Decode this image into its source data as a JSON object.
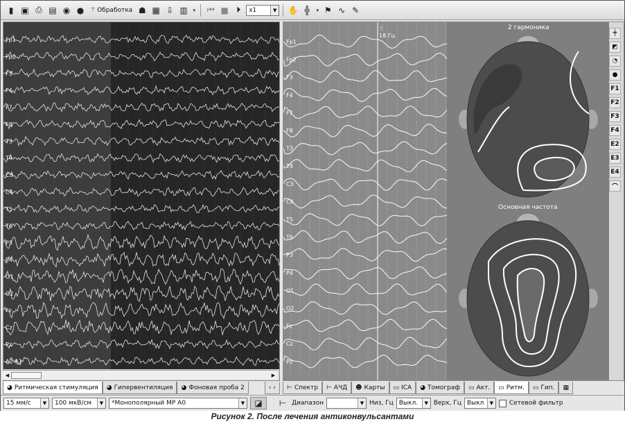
{
  "toolbar": {
    "processing_label": "Обработка",
    "speed_value": "x1"
  },
  "left_channels": [
    "Fp1",
    "Fp2",
    "F3",
    "F4",
    "F7",
    "F8",
    "T3",
    "T4",
    "C3",
    "C4",
    "T5",
    "T6",
    "P3",
    "P4",
    "O1",
    "O2",
    "Fz",
    "Cz",
    "Pz",
    "A2-A1"
  ],
  "right_channels": [
    "Fp1",
    "Fp2",
    "F3",
    "F4",
    "F7",
    "F8",
    "T3",
    "T4",
    "C3",
    "C4",
    "T5",
    "T6",
    "P3",
    "P4",
    "O1",
    "O2",
    "Fz",
    "Cz",
    "Pz"
  ],
  "cursor_readout": "18 Гц",
  "maps": {
    "top_title": "2 гармоника",
    "bottom_title": "Основная частота"
  },
  "left_tabs": [
    {
      "label": "Ритмическая стимуляция",
      "icon": "photic-icon"
    },
    {
      "label": "Гипервентиляция",
      "icon": "breath-icon"
    },
    {
      "label": "Фоновая проба 2",
      "icon": "background-icon"
    }
  ],
  "right_tabs": [
    {
      "label": "Спектр",
      "icon": "spectrum-icon"
    },
    {
      "label": "АЧД",
      "icon": "afc-icon"
    },
    {
      "label": "Карты",
      "icon": "maps-icon"
    },
    {
      "label": "ICA",
      "icon": "ica-icon"
    },
    {
      "label": "Томограф",
      "icon": "tomograph-icon"
    },
    {
      "label": "Акт.",
      "icon": "activity-icon"
    },
    {
      "label": "Ритм.",
      "icon": "rhythm-icon"
    },
    {
      "label": "Гип.",
      "icon": "hyper-icon"
    }
  ],
  "status": {
    "speed": "15 мм/с",
    "sensitivity": "100 мкВ/см",
    "montage": "*Монополярный МР А0",
    "range_label": "Диапазон",
    "low_label": "Низ, Гц",
    "low_value": "Выкл.",
    "high_label": "Верх, Гц",
    "high_value": "Выкл",
    "notch_label": "Сетевой фильтр"
  },
  "side_palette": [
    "F1",
    "F2",
    "F3",
    "F4"
  ],
  "caption": "Рисунок 2. После лечения антиконвульсантами"
}
